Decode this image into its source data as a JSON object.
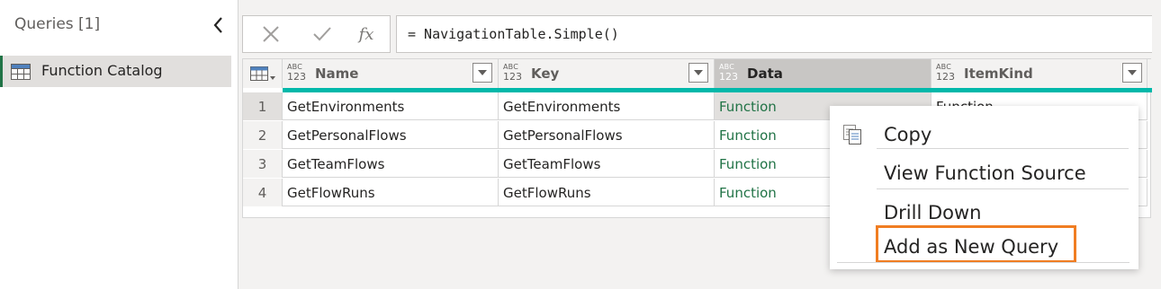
{
  "queries_pane": {
    "header": "Queries [1]",
    "items": [
      {
        "label": "Function Catalog"
      }
    ]
  },
  "formula_bar": {
    "fx_label": "fx",
    "formula": "= NavigationTable.Simple()"
  },
  "grid": {
    "type_badge": {
      "line1": "ABC",
      "line2": "123"
    },
    "columns": [
      {
        "label": "Name"
      },
      {
        "label": "Key"
      },
      {
        "label": "Data"
      },
      {
        "label": "ItemKind"
      }
    ],
    "rows": [
      {
        "num": "1",
        "cells": [
          "GetEnvironments",
          "GetEnvironments",
          "Function",
          "Function"
        ]
      },
      {
        "num": "2",
        "cells": [
          "GetPersonalFlows",
          "GetPersonalFlows",
          "Function",
          ""
        ]
      },
      {
        "num": "3",
        "cells": [
          "GetTeamFlows",
          "GetTeamFlows",
          "Function",
          ""
        ]
      },
      {
        "num": "4",
        "cells": [
          "GetFlowRuns",
          "GetFlowRuns",
          "Function",
          ""
        ]
      }
    ]
  },
  "context_menu": {
    "items": [
      {
        "label": "Copy"
      },
      {
        "label": "View Function Source"
      },
      {
        "label": "Drill Down"
      },
      {
        "label": "Add as New Query"
      }
    ]
  },
  "colors": {
    "accent_green": "#217346",
    "quality_bar": "#01b8aa",
    "highlight": "#f07d22"
  }
}
